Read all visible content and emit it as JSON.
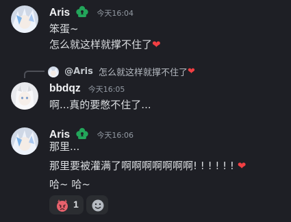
{
  "messages": [
    {
      "username": "Aris",
      "timestamp": "今天16:04",
      "lines": [
        "笨蛋~",
        "怎么就这样就撑不住了"
      ]
    },
    {
      "reply": {
        "username": "@Aris",
        "text": "怎么就这样就撑不住了"
      },
      "username": "bbdqz",
      "timestamp": "今天16:05",
      "lines": [
        "啊...真的要憋不住了..."
      ]
    },
    {
      "username": "Aris",
      "timestamp": "今天16:06",
      "lines": [
        "那里...",
        "那里要被灌满了啊啊啊啊啊啊啊! ! ! ! ! !",
        "哈~ 哈~"
      ]
    }
  ],
  "reactions": [
    {
      "emoji": "angry-face-with-horns-icon",
      "count": "1"
    },
    {
      "emoji": "add-reaction-icon",
      "count": ""
    }
  ],
  "colors": {
    "background": "#1e1f25",
    "username": "#f2f3f5",
    "timestamp": "#949ba4",
    "text": "#dbdee1",
    "heart": "#f23f43",
    "badge_green": "#23a55a"
  }
}
